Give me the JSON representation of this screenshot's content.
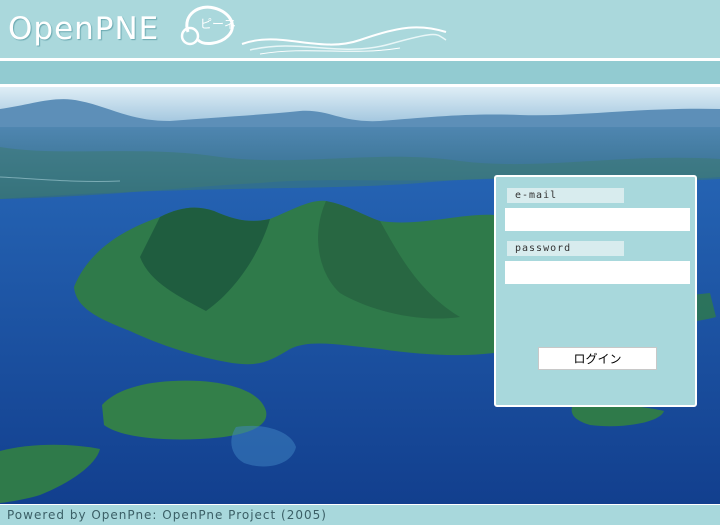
{
  "header": {
    "logo_text": "OpenPNE",
    "logo_badge_text": "ピーネ"
  },
  "login": {
    "email_label": "e-mail",
    "password_label": "password",
    "email_value": "",
    "password_value": "",
    "login_button": "ログイン"
  },
  "footer": {
    "text": "Powered by OpenPne: OpenPne Project (2005)"
  },
  "colors": {
    "header_bg": "#aad8dc",
    "band": "#92cbd1",
    "panel_bg": "#a8d8dc",
    "lake": "#1e5fb0",
    "island": "#2f7a4a"
  },
  "scene": {
    "description_icon": "aerial-lake-photo"
  }
}
